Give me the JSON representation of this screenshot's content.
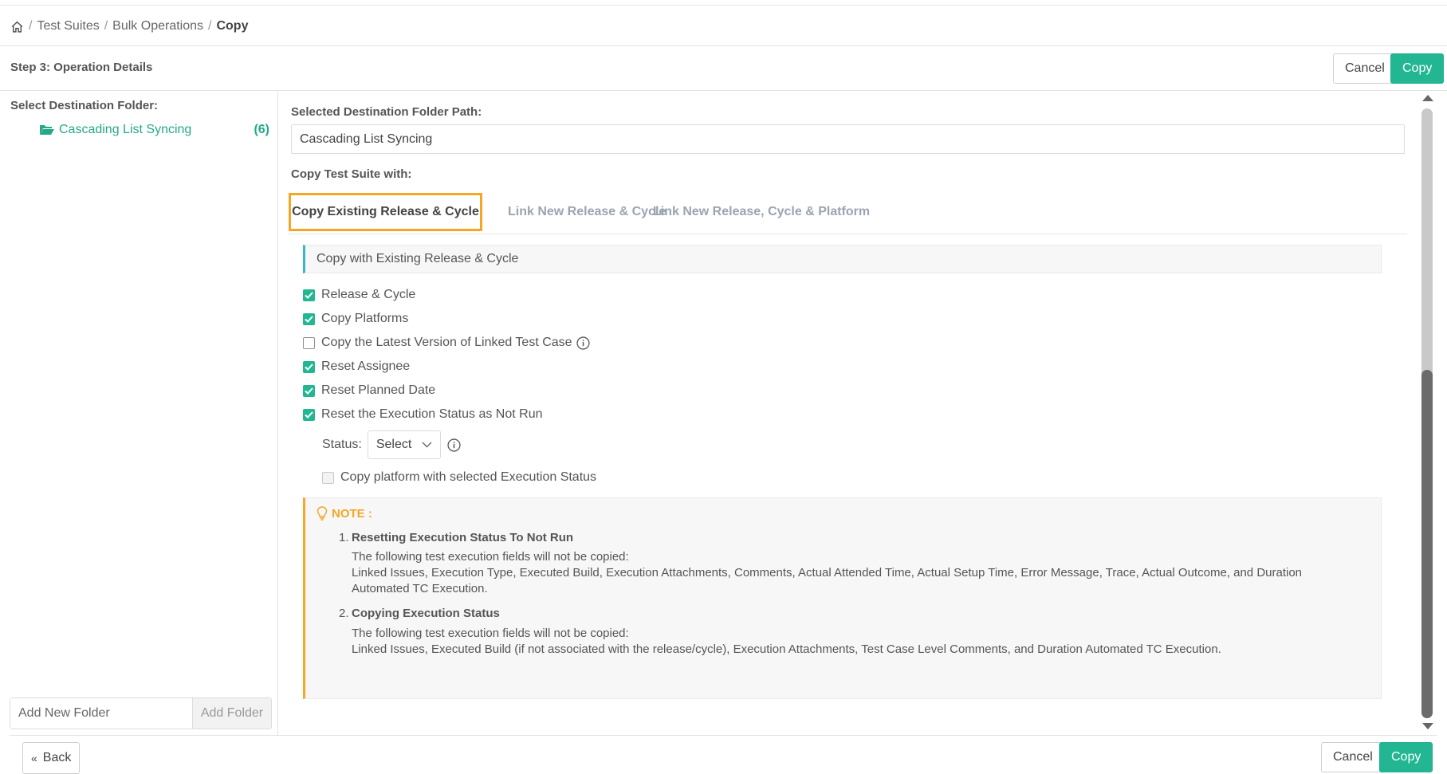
{
  "breadcrumb": {
    "items": [
      "Test Suites",
      "Bulk Operations"
    ],
    "current": "Copy"
  },
  "header": {
    "step_title": "Step 3: Operation Details",
    "cancel_label": "Cancel",
    "copy_label": "Copy"
  },
  "left": {
    "label": "Select Destination Folder:",
    "folder": {
      "name": "Cascading List Syncing",
      "count": "(6)"
    },
    "add_folder": {
      "placeholder": "Add New Folder",
      "button": "Add Folder"
    }
  },
  "main": {
    "dest_label": "Selected Destination Folder Path:",
    "dest_value": "Cascading List Syncing",
    "copy_with_label": "Copy Test Suite with:",
    "tabs": [
      {
        "label": "Copy Existing Release & Cycle",
        "active": true
      },
      {
        "label": "Link New Release & Cycle",
        "active": false
      },
      {
        "label": "Link New Release, Cycle & Platform",
        "active": false
      }
    ],
    "section_title": "Copy with Existing Release & Cycle",
    "options": [
      {
        "label": "Release & Cycle",
        "checked": true
      },
      {
        "label": "Copy Platforms",
        "checked": true
      },
      {
        "label": "Copy the Latest Version of Linked Test Case",
        "checked": false
      },
      {
        "label": "Reset Assignee",
        "checked": true
      },
      {
        "label": "Reset Planned Date",
        "checked": true
      },
      {
        "label": "Reset the Execution Status as Not Run",
        "checked": true
      }
    ],
    "status": {
      "label": "Status:",
      "value": "Select"
    },
    "copy_platform_label": "Copy platform with selected Execution Status",
    "note": {
      "title": "NOTE :",
      "items": [
        {
          "num": "1.",
          "heading": "Resetting Execution Status To Not Run",
          "line1": "The following test execution fields will not be copied:",
          "line2": "Linked Issues, Execution Type, Executed Build, Execution Attachments, Comments, Actual Attended Time, Actual Setup Time, Error Message, Trace, Actual Outcome, and Duration",
          "line3": "Automated TC Execution."
        },
        {
          "num": "2.",
          "heading": "Copying Execution Status",
          "line1": "The following test execution fields will not be copied:",
          "line2": "Linked Issues, Executed Build (if not associated with the release/cycle), Execution Attachments, Test Case Level Comments, and Duration Automated TC Execution."
        }
      ]
    }
  },
  "footer": {
    "back_label": "Back",
    "cancel_label": "Cancel",
    "copy_label": "Copy"
  },
  "colors": {
    "accent": "#23b693",
    "tab_highlight": "#f5a623",
    "section_bar": "#35b9c7",
    "note_bar": "#f5a623"
  }
}
